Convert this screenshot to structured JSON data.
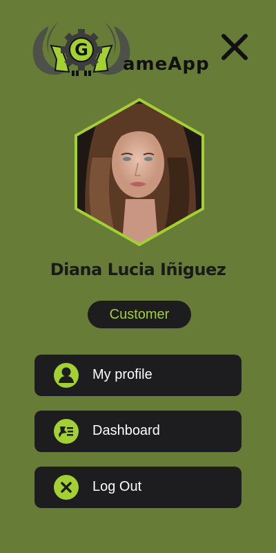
{
  "app": {
    "logo_text": "ameApp",
    "logo_badge_letter": "G"
  },
  "colors": {
    "background": "#677c36",
    "accent": "#a3d133",
    "dark": "#1d1c1e"
  },
  "header": {
    "close_icon": "close-icon"
  },
  "profile": {
    "name": "Diana Lucia Iñiguez",
    "role": "Customer",
    "avatar_icon": "avatar"
  },
  "menu": {
    "items": [
      {
        "label": "My profile",
        "icon": "user-icon"
      },
      {
        "label": "Dashboard",
        "icon": "dashboard-icon"
      },
      {
        "label": "Log Out",
        "icon": "logout-x-icon"
      }
    ]
  }
}
